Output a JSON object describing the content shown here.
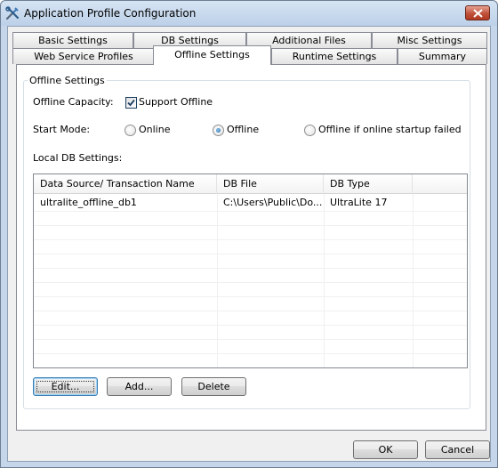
{
  "window": {
    "title": "Application Profile Configuration",
    "close_label": "close"
  },
  "tabs": {
    "row_top": [
      "Basic Settings",
      "DB Settings",
      "Additional Files",
      "Misc Settings"
    ],
    "row_bottom": [
      "Web Service Profiles",
      "Offline Settings",
      "Runtime Settings",
      "Summary"
    ],
    "active": "Offline Settings"
  },
  "offline": {
    "group_title": "Offline Settings",
    "capacity_label": "Offline Capacity:",
    "support_offline_label": "Support Offline",
    "support_offline_checked": true,
    "start_mode_label": "Start Mode:",
    "start_modes": [
      "Online",
      "Offline",
      "Offline if online startup failed"
    ],
    "start_mode_selected": "Offline",
    "local_db_label": "Local DB Settings:"
  },
  "db_table": {
    "columns": [
      "Data Source/ Transaction Name",
      "DB File",
      "DB Type"
    ],
    "rows": [
      [
        "ultralite_offline_db1",
        "C:\\Users\\Public\\Do...",
        "UltraLite 17"
      ]
    ]
  },
  "buttons": {
    "edit": "Edit...",
    "add": "Add...",
    "delete": "Delete",
    "ok": "OK",
    "cancel": "Cancel"
  },
  "colors": {
    "titlebar": "#bcd0e8",
    "close_button": "#c0513a",
    "dialog_bg": "#f0f0f0",
    "radio_dot": "#1f5f9c"
  }
}
